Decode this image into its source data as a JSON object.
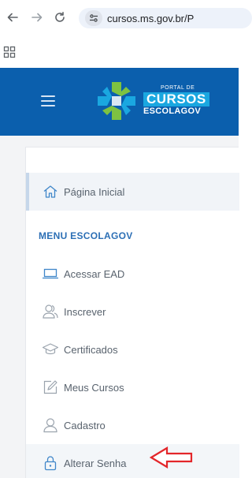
{
  "browser": {
    "url": "cursos.ms.gov.br/P"
  },
  "header": {
    "logo_small": "PORTAL DE",
    "logo_main": "CURSOS",
    "logo_sub": "ESCOLAGOV",
    "background_color": "#0b5fad",
    "accent_color": "#1aa7e0"
  },
  "sidebar": {
    "home_label": "Página Inicial",
    "section_heading": "MENU ESCOLAGOV",
    "items": [
      {
        "label": "Acessar EAD",
        "icon": "laptop-icon"
      },
      {
        "label": "Inscrever",
        "icon": "users-icon"
      },
      {
        "label": "Certificados",
        "icon": "graduation-cap-icon"
      },
      {
        "label": "Meus Cursos",
        "icon": "edit-icon"
      },
      {
        "label": "Cadastro",
        "icon": "user-icon"
      },
      {
        "label": "Alterar Senha",
        "icon": "lock-icon"
      }
    ]
  },
  "annotation": {
    "arrow_color": "#e3262a"
  }
}
